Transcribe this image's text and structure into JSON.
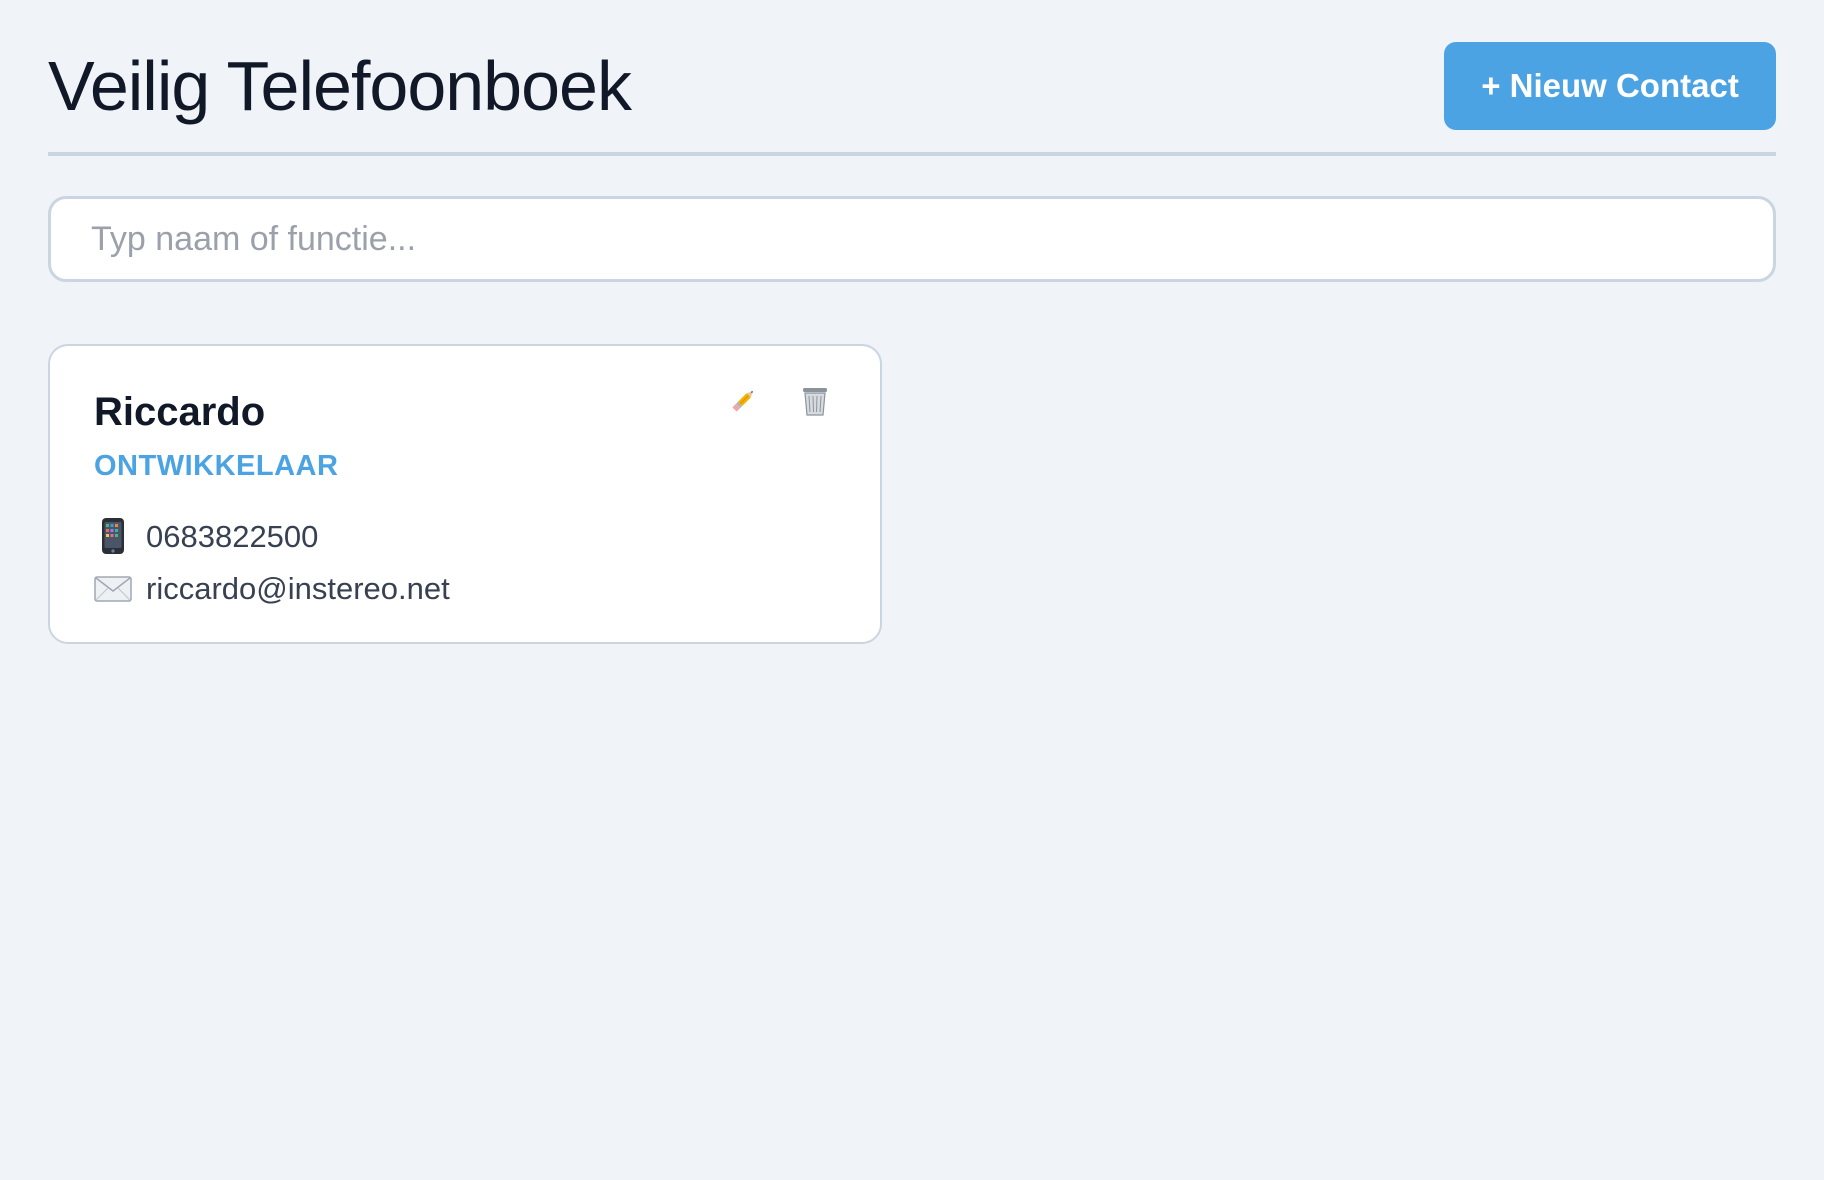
{
  "header": {
    "title": "Veilig Telefoonboek",
    "new_contact_label": "+ Nieuw Contact"
  },
  "search": {
    "placeholder": "Typ naam of functie...",
    "value": ""
  },
  "contacts": [
    {
      "name": "Riccardo",
      "role": "ONTWIKKELAAR",
      "phone": "0683822500",
      "email": "riccardo@instereo.net",
      "phone_icon": "mobile-phone-icon",
      "email_icon": "envelope-icon",
      "actions": [
        "pencil-icon",
        "trash-icon"
      ]
    }
  ],
  "colors": {
    "accent": "#4ba3e3",
    "background": "#f0f4f8",
    "border": "#cbd5e1"
  }
}
